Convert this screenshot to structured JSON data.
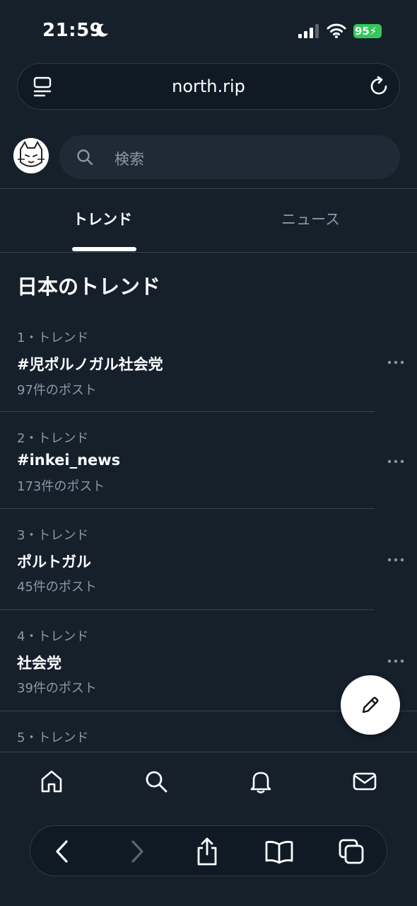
{
  "status_bar": {
    "time": "21:59",
    "battery": "95"
  },
  "browser": {
    "url": "north.rip"
  },
  "search": {
    "placeholder": "検索"
  },
  "tabs": [
    {
      "label": "トレンド",
      "active": true
    },
    {
      "label": "ニュース",
      "active": false
    }
  ],
  "section_title": "日本のトレンド",
  "trends": [
    {
      "rank": "1・トレンド",
      "name": "#児ポルノガル社会党",
      "count": "97件のポスト"
    },
    {
      "rank": "2・トレンド",
      "name": "#inkei_news",
      "count": "173件のポスト"
    },
    {
      "rank": "3・トレンド",
      "name": "ポルトガル",
      "count": "45件のポスト"
    },
    {
      "rank": "4・トレンド",
      "name": "社会党",
      "count": "39件のポスト"
    },
    {
      "rank": "5・トレンド"
    }
  ],
  "icons": {
    "compose": "pencil-icon",
    "nav": [
      "home-icon",
      "search-icon",
      "bell-icon",
      "mail-icon"
    ],
    "browser": [
      "back-icon",
      "forward-icon",
      "share-icon",
      "bookmarks-icon",
      "tabs-icon"
    ]
  },
  "colors": {
    "background": "#15202b",
    "battery": "#34c759",
    "muted_text": "#8b98a5"
  }
}
